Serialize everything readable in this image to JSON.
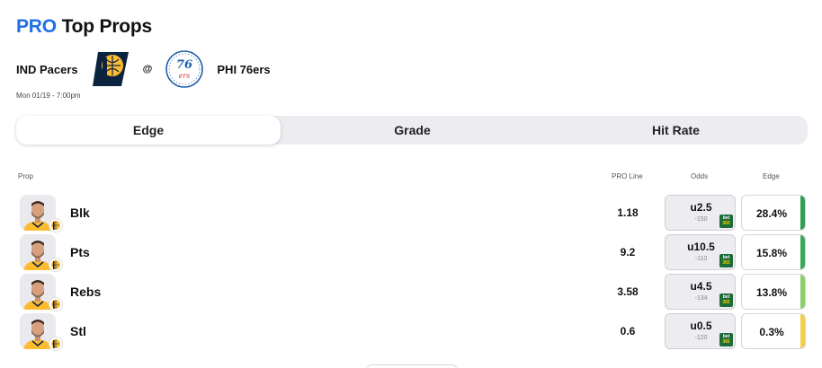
{
  "header": {
    "title_pro": "PRO",
    "title_rest": "Top Props"
  },
  "game": {
    "away_team": "IND Pacers",
    "at_symbol": "@",
    "home_team": "PHI 76ers",
    "datetime": "Mon 01/19 - 7:00pm"
  },
  "tabs": [
    {
      "label": "Edge",
      "active": true
    },
    {
      "label": "Grade",
      "active": false
    },
    {
      "label": "Hit Rate",
      "active": false
    }
  ],
  "columns": {
    "prop": "Prop",
    "pro_line": "PRO Line",
    "odds": "Odds",
    "edge": "Edge"
  },
  "props": [
    {
      "stat": "Blk",
      "pro_line": "1.18",
      "odds_line": "u2.5",
      "odds_price": "-150",
      "edge": "28.4%",
      "edge_color": "#2e9e4f"
    },
    {
      "stat": "Pts",
      "pro_line": "9.2",
      "odds_line": "u10.5",
      "odds_price": "-110",
      "edge": "15.8%",
      "edge_color": "#3ea85a"
    },
    {
      "stat": "Rebs",
      "pro_line": "3.58",
      "odds_line": "u4.5",
      "odds_price": "-134",
      "edge": "13.8%",
      "edge_color": "#8ccf6a"
    },
    {
      "stat": "Stl",
      "pro_line": "0.6",
      "odds_line": "u0.5",
      "odds_price": "-120",
      "edge": "0.3%",
      "edge_color": "#f2cf4a"
    }
  ],
  "sportsbook": {
    "top": "bet",
    "bottom": "365"
  },
  "colors": {
    "accent": "#1f6fe5",
    "pacers_navy": "#0c2340",
    "pacers_gold": "#fdbb30",
    "sixers_blue": "#1d5fa8",
    "sixers_red": "#e03a3e"
  }
}
